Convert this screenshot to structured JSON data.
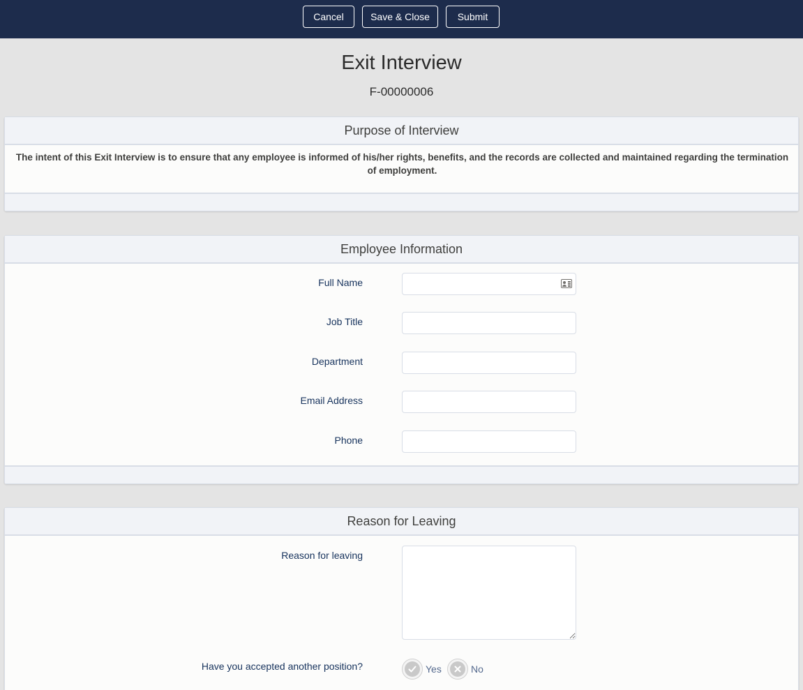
{
  "toolbar": {
    "cancel_label": "Cancel",
    "save_close_label": "Save & Close",
    "submit_label": "Submit"
  },
  "form": {
    "title": "Exit Interview",
    "id": "F-00000006"
  },
  "purpose_section": {
    "title": "Purpose of Interview",
    "text": "The intent of this Exit Interview is to ensure that any employee is informed of his/her rights, benefits, and the records are collected and maintained regarding the termination of employment."
  },
  "employee_section": {
    "title": "Employee Information",
    "fields": [
      {
        "label": "Full Name",
        "value": "",
        "icon": "contact-card-icon"
      },
      {
        "label": "Job Title",
        "value": ""
      },
      {
        "label": "Department",
        "value": ""
      },
      {
        "label": "Email Address",
        "value": ""
      },
      {
        "label": "Phone",
        "value": ""
      }
    ]
  },
  "reason_section": {
    "title": "Reason for Leaving",
    "reason_label": "Reason for leaving",
    "reason_value": "",
    "accepted_question": "Have you accepted another position?",
    "options": [
      {
        "label": "Yes",
        "icon": "check-icon"
      },
      {
        "label": "No",
        "icon": "x-icon"
      }
    ]
  },
  "colors": {
    "topbar": "#1d2c4c",
    "page_bg": "#e4e4e4",
    "label": "#16325c",
    "card_header": "#f1f3f7"
  }
}
